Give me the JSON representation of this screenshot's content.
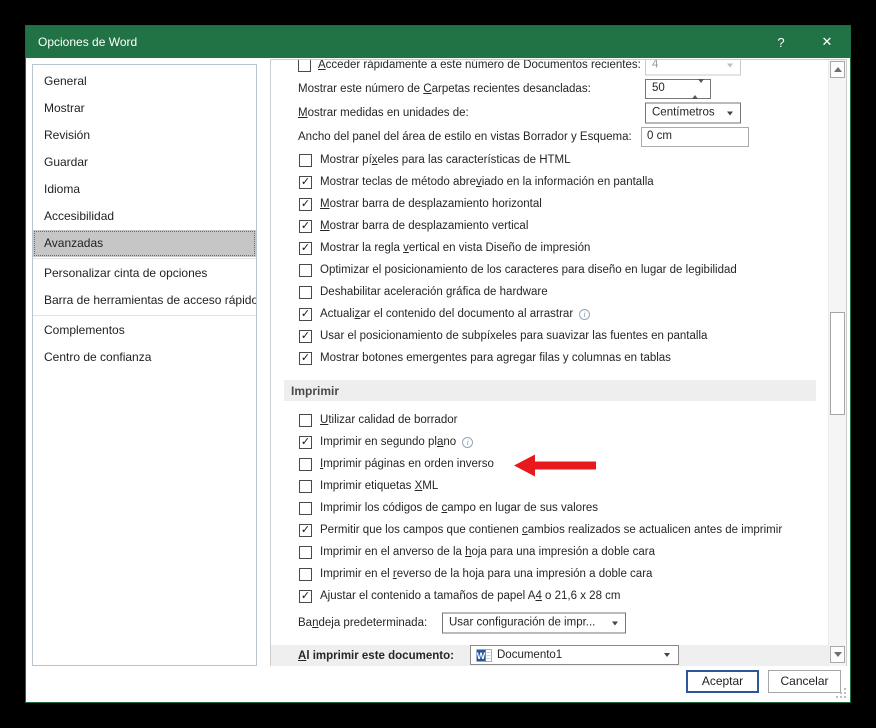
{
  "window": {
    "title": "Opciones de Word",
    "help_label": "?",
    "close_label": "✕"
  },
  "sidebar": {
    "items": [
      {
        "label": "General"
      },
      {
        "label": "Mostrar"
      },
      {
        "label": "Revisión"
      },
      {
        "label": "Guardar"
      },
      {
        "label": "Idioma"
      },
      {
        "label": "Accesibilidad"
      },
      {
        "label": "Avanzadas",
        "selected": true
      },
      {
        "separator": true
      },
      {
        "label": "Personalizar cinta de opciones"
      },
      {
        "label": "Barra de herramientas de acceso rápido"
      },
      {
        "separator": true
      },
      {
        "label": "Complementos"
      },
      {
        "label": "Centro de confianza"
      }
    ]
  },
  "panel": {
    "top_rows": [
      {
        "label": "_Acceder rápidamente a este número de Documentos recientes:",
        "checkbox": true,
        "checked": false,
        "control": "dropdown",
        "value": "4",
        "disabled": true
      },
      {
        "label": "Mostrar este número de _Carpetas recientes desancladas:",
        "control": "spinner",
        "value": "50"
      },
      {
        "label": "_Mostrar medidas en unidades de:",
        "control": "dropdown",
        "value": "Centímetros"
      },
      {
        "label": "Ancho del panel del área de estilo en vistas Borrador y Esquema:",
        "control": "input",
        "value": "0 cm"
      }
    ],
    "display_rows": [
      {
        "label": "Mostrar pí_xeles para las características de HTML",
        "checked": false
      },
      {
        "label": "Mostrar teclas de método abre_viado en la información en pantalla",
        "checked": true
      },
      {
        "label": "_Mostrar barra de desplazamiento horizontal",
        "checked": true
      },
      {
        "label": "_Mostrar barra de desplazamiento vertical",
        "checked": true
      },
      {
        "label": "Mostrar la regla _vertical en vista Diseño de impresión",
        "checked": true
      },
      {
        "label": "Optimizar el posicionamiento de los caracteres para diseño en lugar de legibilidad",
        "checked": false
      },
      {
        "label": "Deshabilitar aceleración _gráfica de hardware",
        "checked": false
      },
      {
        "label": "Actuali_zar el contenido del documento al arrastrar",
        "checked": true,
        "info": true
      },
      {
        "label": "Usar el posicionamiento de subpíxeles para suavizar las fuentes en pantalla",
        "checked": true
      },
      {
        "label": "Mostrar botones emergentes para agregar filas y columnas en tablas",
        "checked": true
      }
    ],
    "print_section_title": "Imprimir",
    "print_rows": [
      {
        "label": "_Utilizar calidad de borrador",
        "checked": false
      },
      {
        "label": "Imprimir en segundo pl_ano",
        "checked": true,
        "info": true
      },
      {
        "label": "_Imprimir páginas en orden inverso",
        "checked": false,
        "annotated": true
      },
      {
        "label": "Imprimir etiquetas _XML",
        "checked": false
      },
      {
        "label": "Imprimir los códigos de _campo en lugar de sus valores",
        "checked": false
      },
      {
        "label": "Permitir que los campos que contienen _cambios realizados se actualicen antes de imprimir",
        "checked": true
      },
      {
        "label": "Imprimir en el anverso de la _hoja para una impresión a doble cara",
        "checked": false
      },
      {
        "label": "Imprimir en el _reverso de la hoja para una impresión a doble cara",
        "checked": false
      },
      {
        "label": "Ajustar el contenido a tamaños de papel A_4 o 21,6 x 28 cm",
        "checked": true
      }
    ],
    "tray_label": "Ba_ndeja predeterminada:",
    "tray_value": "Usar configuración de impr...",
    "print_doc_label": "_Al imprimir este documento:",
    "print_doc_value": "Documento1"
  },
  "footer": {
    "ok_label": "Aceptar",
    "cancel_label": "Cancelar"
  },
  "icons": {
    "checkmark": "✓",
    "info": "i",
    "word_doc": "W"
  },
  "colors": {
    "title_green": "#217346",
    "accent_blue": "#2b579a",
    "arrow_red": "#e8191d",
    "selected_gray": "#c6c6c6",
    "section_band": "#eeeeee"
  }
}
